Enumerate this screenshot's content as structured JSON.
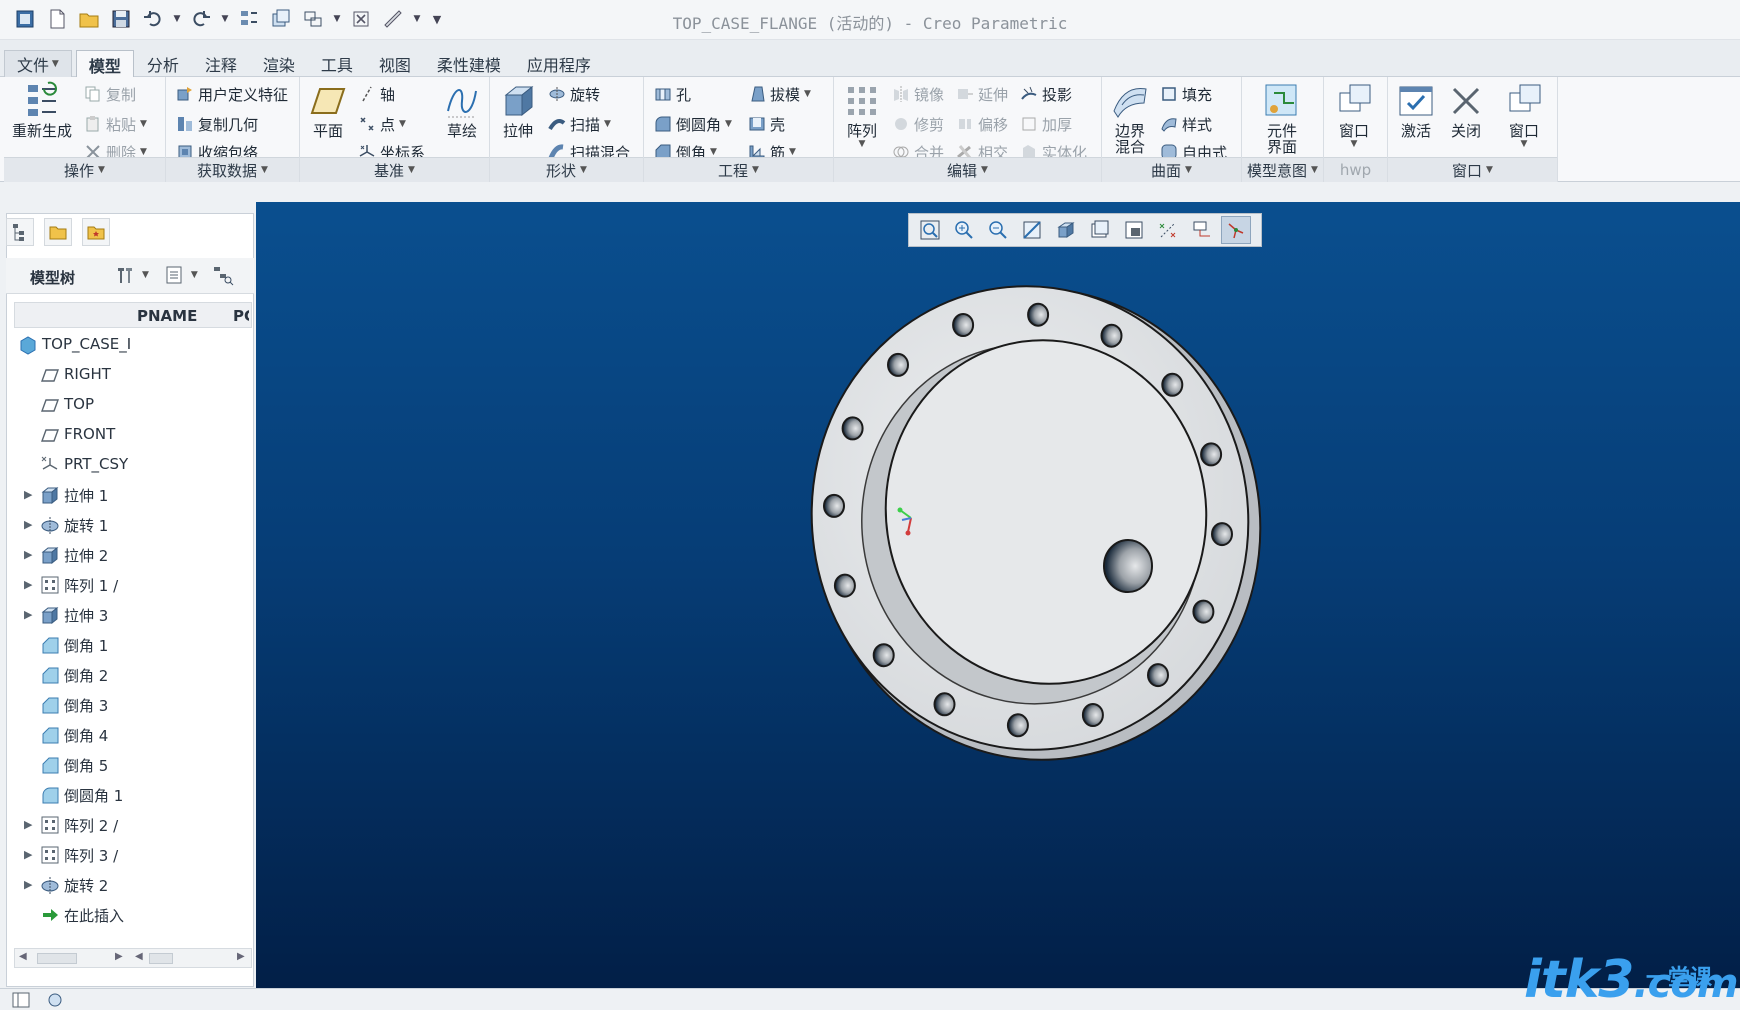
{
  "window": {
    "title": "TOP_CASE_FLANGE (活动的) - Creo Parametric"
  },
  "menu_tabs": [
    "文件",
    "模型",
    "分析",
    "注释",
    "渲染",
    "工具",
    "视图",
    "柔性建模",
    "应用程序"
  ],
  "active_tab": "模型",
  "ribbon": {
    "operations": {
      "label": "操作",
      "regenerate": "重新生成",
      "copy": "复制",
      "paste": "粘贴",
      "delete": "删除"
    },
    "get_data": {
      "label": "获取数据",
      "udf": "用户定义特征",
      "copy_geom": "复制几何",
      "shrinkwrap": "收缩包络"
    },
    "datum": {
      "label": "基准",
      "plane": "平面",
      "axis": "轴",
      "point": "点",
      "csys": "坐标系",
      "sketch": "草绘"
    },
    "shapes": {
      "label": "形状",
      "extrude": "拉伸",
      "revolve": "旋转",
      "sweep": "扫描",
      "swept_blend": "扫描混合"
    },
    "engineering": {
      "label": "工程",
      "hole": "孔",
      "round": "倒圆角",
      "chamfer": "倒角",
      "draft": "拔模",
      "shell": "壳",
      "rib": "筋"
    },
    "editing": {
      "label": "编辑",
      "pattern": "阵列",
      "mirror": "镜像",
      "trim": "修剪",
      "merge": "合并",
      "extend": "延伸",
      "offset": "偏移",
      "intersect": "相交",
      "project": "投影",
      "thicken": "加厚",
      "solidify": "实体化"
    },
    "surfaces": {
      "label": "曲面",
      "boundary_blend": "边界混合",
      "fill": "填充",
      "style": "样式",
      "freestyle": "自由式"
    },
    "model_intent": {
      "label": "模型意图",
      "component_interface": "元件界面"
    },
    "hwp": {
      "label": "hwp"
    },
    "window": {
      "label": "窗口",
      "window": "窗口",
      "activate": "激活",
      "close": "关闭",
      "window2": "窗口"
    }
  },
  "model_tree": {
    "title": "模型树",
    "columns": [
      "PNAME",
      "PC"
    ],
    "items": [
      {
        "label": "TOP_CASE_I",
        "icon": "part-icon",
        "expandable": false,
        "level": 0
      },
      {
        "label": "RIGHT",
        "icon": "datum-plane-icon",
        "expandable": false,
        "level": 1
      },
      {
        "label": "TOP",
        "icon": "datum-plane-icon",
        "expandable": false,
        "level": 1
      },
      {
        "label": "FRONT",
        "icon": "datum-plane-icon",
        "expandable": false,
        "level": 1
      },
      {
        "label": "PRT_CSY",
        "icon": "csys-icon",
        "expandable": false,
        "level": 1
      },
      {
        "label": "拉伸 1",
        "icon": "extrude-icon",
        "expandable": true,
        "level": 1
      },
      {
        "label": "旋转 1",
        "icon": "revolve-icon",
        "expandable": true,
        "level": 1
      },
      {
        "label": "拉伸 2",
        "icon": "extrude-icon",
        "expandable": true,
        "level": 1
      },
      {
        "label": "阵列 1 /",
        "icon": "pattern-icon",
        "expandable": true,
        "level": 1
      },
      {
        "label": "拉伸 3",
        "icon": "extrude-icon",
        "expandable": true,
        "level": 1
      },
      {
        "label": "倒角 1",
        "icon": "chamfer-icon",
        "expandable": false,
        "level": 1
      },
      {
        "label": "倒角 2",
        "icon": "chamfer-icon",
        "expandable": false,
        "level": 1
      },
      {
        "label": "倒角 3",
        "icon": "chamfer-icon",
        "expandable": false,
        "level": 1
      },
      {
        "label": "倒角 4",
        "icon": "chamfer-icon",
        "expandable": false,
        "level": 1
      },
      {
        "label": "倒角 5",
        "icon": "chamfer-icon",
        "expandable": false,
        "level": 1
      },
      {
        "label": "倒圆角 1",
        "icon": "round-icon",
        "expandable": false,
        "level": 1
      },
      {
        "label": "阵列 2 /",
        "icon": "pattern-icon",
        "expandable": true,
        "level": 1
      },
      {
        "label": "阵列 3 /",
        "icon": "pattern-icon",
        "expandable": true,
        "level": 1
      },
      {
        "label": "旋转 2",
        "icon": "revolve-icon",
        "expandable": true,
        "level": 1
      },
      {
        "label": "在此插入",
        "icon": "insert-here-icon",
        "expandable": false,
        "level": 1
      }
    ]
  },
  "watermark": {
    "text": "itk3",
    "suffix": ".com",
    "cn": "一堂课"
  },
  "colors": {
    "viewport_top": "#0a4f8f",
    "viewport_bottom": "#021f47",
    "model_face": "#e4e6e8",
    "accent": "#3aa0ee"
  }
}
